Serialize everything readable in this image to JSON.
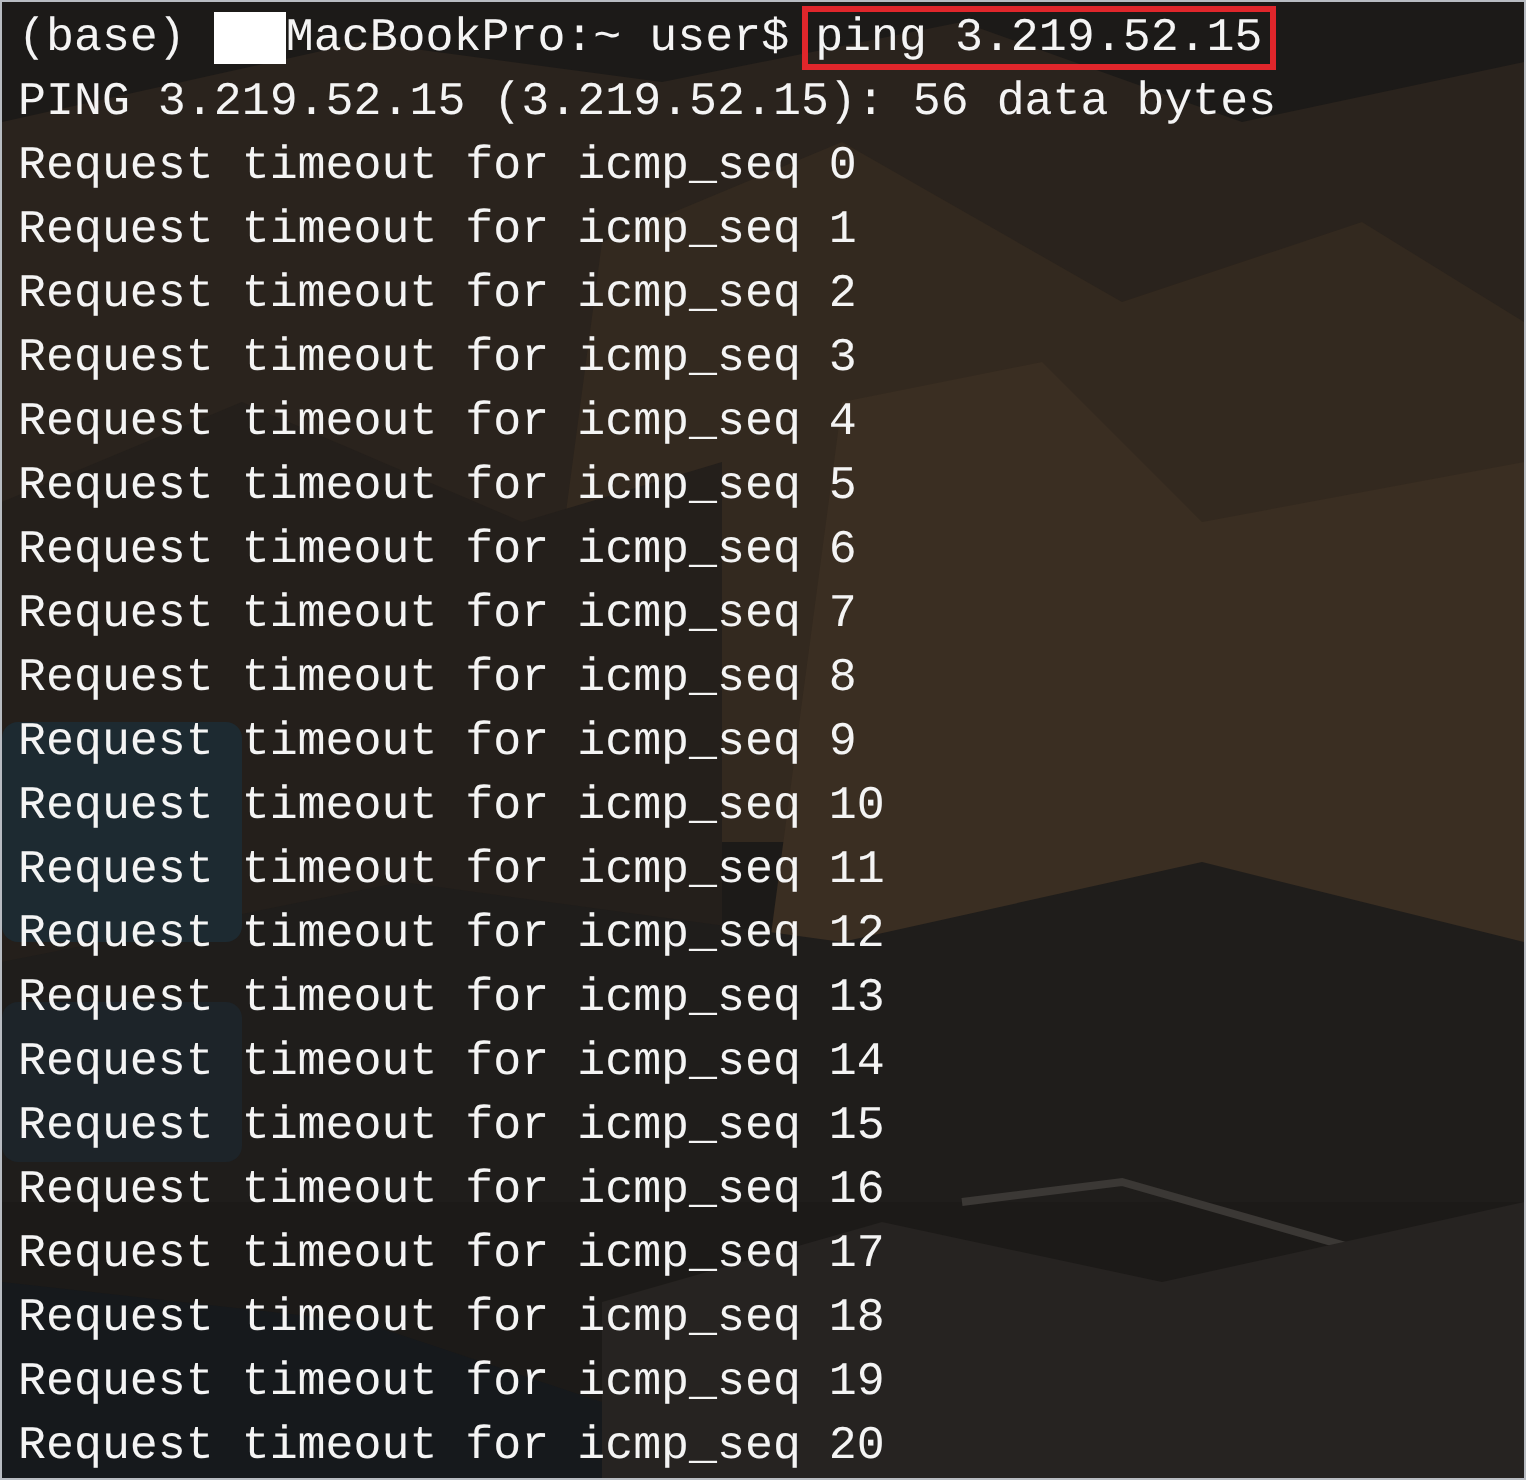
{
  "prompt": {
    "env": "(base)",
    "redacted": true,
    "host": "MacBookPro:~",
    "user": "user$",
    "command": "ping 3.219.52.15",
    "command_highlighted": true
  },
  "output": [
    "PING 3.219.52.15 (3.219.52.15): 56 data bytes",
    "Request timeout for icmp_seq 0",
    "Request timeout for icmp_seq 1",
    "Request timeout for icmp_seq 2",
    "Request timeout for icmp_seq 3",
    "Request timeout for icmp_seq 4",
    "Request timeout for icmp_seq 5",
    "Request timeout for icmp_seq 6",
    "Request timeout for icmp_seq 7",
    "Request timeout for icmp_seq 8",
    "Request timeout for icmp_seq 9",
    "Request timeout for icmp_seq 10",
    "Request timeout for icmp_seq 11",
    "Request timeout for icmp_seq 12",
    "Request timeout for icmp_seq 13",
    "Request timeout for icmp_seq 14",
    "Request timeout for icmp_seq 15",
    "Request timeout for icmp_seq 16",
    "Request timeout for icmp_seq 17",
    "Request timeout for icmp_seq 18",
    "Request timeout for icmp_seq 19",
    "Request timeout for icmp_seq 20"
  ]
}
